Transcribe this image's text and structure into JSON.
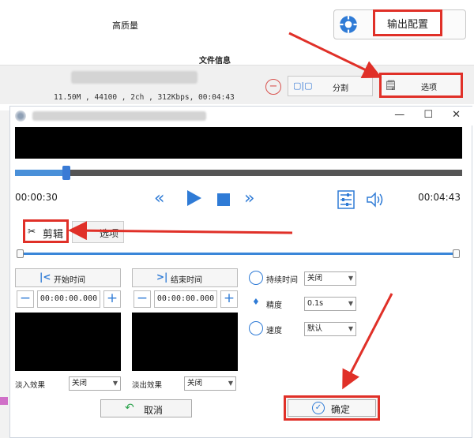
{
  "top": {
    "quality_text": "高质量",
    "output_config_label": "输出配置",
    "file_info_label": "文件信息",
    "file_meta": "11.50M , 44100 , 2ch , 312Kbps, 00:04:43",
    "split_label": "分割",
    "options_label": "选项"
  },
  "dialog": {
    "window_controls": "— ☐ ✕",
    "player": {
      "current_time": "00:00:30",
      "total_time": "00:04:43",
      "progress": 0.115
    },
    "tabs": [
      {
        "label": "剪辑"
      },
      {
        "label": "选项"
      }
    ],
    "start": {
      "button_label": "开始时间",
      "value": "00:00:00.000"
    },
    "end": {
      "button_label": "结束时间",
      "value": "00:00:00.000"
    },
    "props": {
      "duration_label": "持续时间",
      "duration_value": "关闭",
      "precision_label": "精度",
      "precision_value": "0.1s",
      "speed_label": "速度",
      "speed_value": "默认"
    },
    "fade_in_label": "淡入效果",
    "fade_in_value": "关闭",
    "fade_out_label": "淡出效果",
    "fade_out_value": "关闭",
    "cancel_label": "取消",
    "ok_label": "确定"
  },
  "colors": {
    "accent": "#2f7bd6",
    "highlight_red": "#e03028"
  }
}
